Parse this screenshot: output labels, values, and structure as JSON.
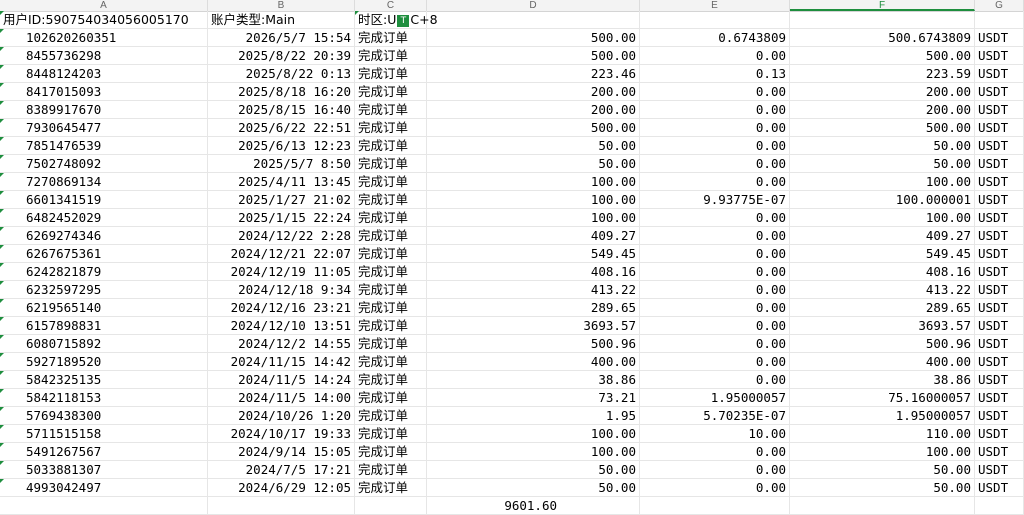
{
  "columns": [
    "A",
    "B",
    "C",
    "D",
    "E",
    "F",
    "G"
  ],
  "selected_column": "F",
  "header": {
    "user_id": "用户ID:590754034056005170",
    "account_type": "账户类型:Main",
    "timezone_prefix": "时区:U",
    "timezone_suffix": "C+8"
  },
  "status_label": "完成订单",
  "currency": "USDT",
  "rows": [
    {
      "id": "102620260351",
      "time": "2026/5/7 15:54",
      "amount": "500.00",
      "fee": "0.6743809",
      "total": "500.6743809"
    },
    {
      "id": "8455736298",
      "time": "2025/8/22 20:39",
      "amount": "500.00",
      "fee": "0.00",
      "total": "500.00"
    },
    {
      "id": "8448124203",
      "time": "2025/8/22 0:13",
      "amount": "223.46",
      "fee": "0.13",
      "total": "223.59"
    },
    {
      "id": "8417015093",
      "time": "2025/8/18 16:20",
      "amount": "200.00",
      "fee": "0.00",
      "total": "200.00"
    },
    {
      "id": "8389917670",
      "time": "2025/8/15 16:40",
      "amount": "200.00",
      "fee": "0.00",
      "total": "200.00"
    },
    {
      "id": "7930645477",
      "time": "2025/6/22 22:51",
      "amount": "500.00",
      "fee": "0.00",
      "total": "500.00"
    },
    {
      "id": "7851476539",
      "time": "2025/6/13 12:23",
      "amount": "50.00",
      "fee": "0.00",
      "total": "50.00"
    },
    {
      "id": "7502748092",
      "time": "2025/5/7 8:50",
      "amount": "50.00",
      "fee": "0.00",
      "total": "50.00"
    },
    {
      "id": "7270869134",
      "time": "2025/4/11 13:45",
      "amount": "100.00",
      "fee": "0.00",
      "total": "100.00"
    },
    {
      "id": "6601341519",
      "time": "2025/1/27 21:02",
      "amount": "100.00",
      "fee": "9.93775E-07",
      "total": "100.000001"
    },
    {
      "id": "6482452029",
      "time": "2025/1/15 22:24",
      "amount": "100.00",
      "fee": "0.00",
      "total": "100.00"
    },
    {
      "id": "6269274346",
      "time": "2024/12/22 2:28",
      "amount": "409.27",
      "fee": "0.00",
      "total": "409.27"
    },
    {
      "id": "6267675361",
      "time": "2024/12/21 22:07",
      "amount": "549.45",
      "fee": "0.00",
      "total": "549.45"
    },
    {
      "id": "6242821879",
      "time": "2024/12/19 11:05",
      "amount": "408.16",
      "fee": "0.00",
      "total": "408.16"
    },
    {
      "id": "6232597295",
      "time": "2024/12/18 9:34",
      "amount": "413.22",
      "fee": "0.00",
      "total": "413.22"
    },
    {
      "id": "6219565140",
      "time": "2024/12/16 23:21",
      "amount": "289.65",
      "fee": "0.00",
      "total": "289.65"
    },
    {
      "id": "6157898831",
      "time": "2024/12/10 13:51",
      "amount": "3693.57",
      "fee": "0.00",
      "total": "3693.57"
    },
    {
      "id": "6080715892",
      "time": "2024/12/2 14:55",
      "amount": "500.96",
      "fee": "0.00",
      "total": "500.96"
    },
    {
      "id": "5927189520",
      "time": "2024/11/15 14:42",
      "amount": "400.00",
      "fee": "0.00",
      "total": "400.00"
    },
    {
      "id": "5842325135",
      "time": "2024/11/5 14:24",
      "amount": "38.86",
      "fee": "0.00",
      "total": "38.86"
    },
    {
      "id": "5842118153",
      "time": "2024/11/5 14:00",
      "amount": "73.21",
      "fee": "1.95000057",
      "total": "75.16000057"
    },
    {
      "id": "5769438300",
      "time": "2024/10/26 1:20",
      "amount": "1.95",
      "fee": "5.70235E-07",
      "total": "1.95000057"
    },
    {
      "id": "5711515158",
      "time": "2024/10/17 19:33",
      "amount": "100.00",
      "fee": "10.00",
      "total": "110.00"
    },
    {
      "id": "5491267567",
      "time": "2024/9/14 15:05",
      "amount": "100.00",
      "fee": "0.00",
      "total": "100.00"
    },
    {
      "id": "5033881307",
      "time": "2024/7/5 17:21",
      "amount": "50.00",
      "fee": "0.00",
      "total": "50.00"
    },
    {
      "id": "4993042497",
      "time": "2024/6/29 12:05",
      "amount": "50.00",
      "fee": "0.00",
      "total": "50.00"
    }
  ],
  "sum": "9601.60",
  "colors": {
    "accent": "#1e8e3e",
    "grid": "#e6e6e6"
  }
}
